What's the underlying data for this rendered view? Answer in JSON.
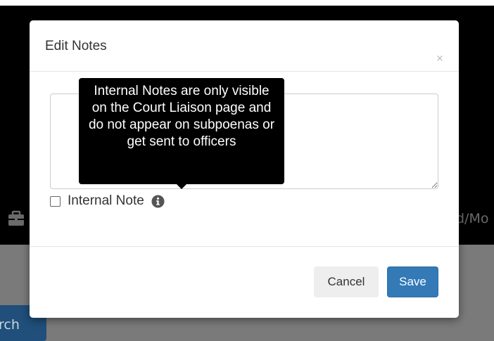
{
  "background": {
    "peek_text": "d/Mo",
    "search_button_fragment": "rch",
    "briefcase_icon": "briefcase-icon",
    "overlay_color": "#000000",
    "lower_color": "#7a7a7a"
  },
  "modal": {
    "title": "Edit Notes",
    "close_label": "×",
    "textarea": {
      "value": "",
      "placeholder": ""
    },
    "internal_note": {
      "label": "Internal Note",
      "checked": false,
      "info_icon": "info-circle-icon"
    },
    "tooltip": {
      "text": "Internal Notes are only visible on the Court Liaison page and do not appear on subpoenas or get sent to officers"
    },
    "buttons": {
      "cancel": "Cancel",
      "save": "Save"
    },
    "colors": {
      "save_bg": "#337ab7",
      "cancel_bg": "#eeeeee",
      "tooltip_bg": "#000000"
    }
  }
}
